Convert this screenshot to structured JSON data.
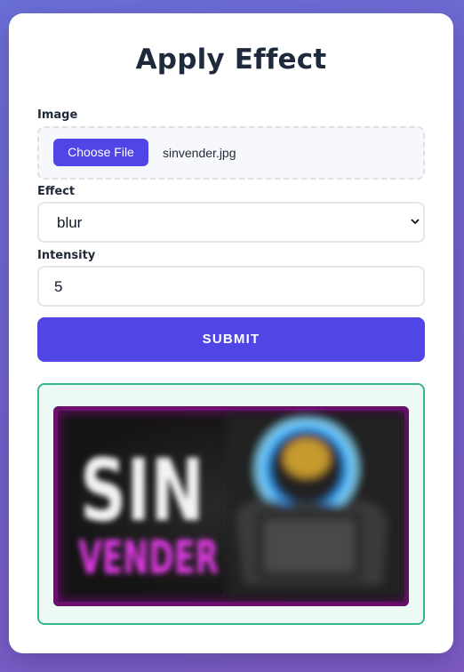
{
  "page": {
    "title": "Apply Effect"
  },
  "form": {
    "image_label": "Image",
    "choose_file_label": "Choose File",
    "file_name": "sinvender.jpg",
    "effect_label": "Effect",
    "effect_value": "blur",
    "intensity_label": "Intensity",
    "intensity_value": "5",
    "submit_label": "SUBMIT"
  },
  "result": {
    "image_text_line1": "SIN",
    "image_text_line2": "VENDER"
  },
  "colors": {
    "accent": "#4f46e5",
    "result_border": "#34b88a",
    "result_bg": "#ecfaf3",
    "image_magenta": "#e23be6"
  },
  "icons": {
    "select_arrow": "chevron-down-icon"
  }
}
